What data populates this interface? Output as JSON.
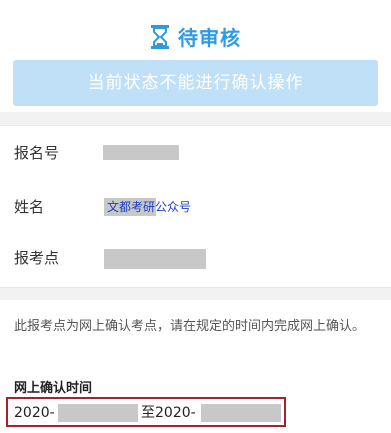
{
  "header": {
    "status_icon": "hourglass-icon",
    "status_title": "待审核",
    "action_button_label": "当前状态不能进行确认操作"
  },
  "info": {
    "registration_number_label": "报名号",
    "name_label": "姓名",
    "name_watermark": "文都考研公众号",
    "exam_site_label": "报考点"
  },
  "notice": {
    "description": "此报考点为网上确认考点，请在规定的时间内完成网上确认。",
    "period_heading": "网上确认时间",
    "period_start_prefix": "2020-",
    "period_separator": "至2020-"
  },
  "colors": {
    "accent": "#2e9be0",
    "button_disabled": "#bfe0f7",
    "highlight_border": "#a4242e"
  }
}
